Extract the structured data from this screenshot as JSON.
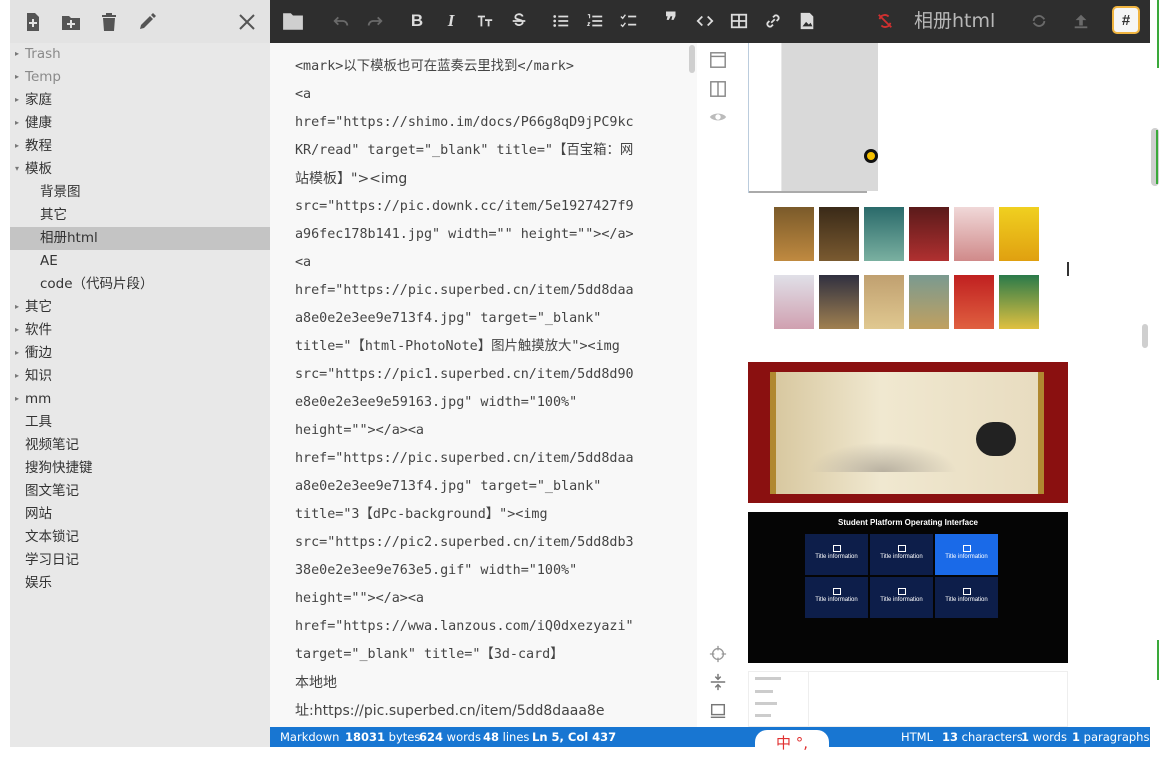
{
  "sidebar": {
    "tree": [
      {
        "label": "Trash",
        "arrow": "▸",
        "muted": true
      },
      {
        "label": "Temp",
        "arrow": "▸",
        "muted": true
      },
      {
        "label": "家庭",
        "arrow": "▸"
      },
      {
        "label": "健康",
        "arrow": "▸"
      },
      {
        "label": "教程",
        "arrow": "▸"
      },
      {
        "label": "模板",
        "arrow": "▾"
      },
      {
        "label": "背景图",
        "child": true
      },
      {
        "label": "其它",
        "child": true
      },
      {
        "label": "相册html",
        "child": true,
        "active": true
      },
      {
        "label": "AE",
        "child": true
      },
      {
        "label": "code（代码片段）",
        "child": true
      },
      {
        "label": "其它",
        "arrow": "▸"
      },
      {
        "label": "软件",
        "arrow": "▸"
      },
      {
        "label": "衝边",
        "arrow": "▸"
      },
      {
        "label": "知识",
        "arrow": "▸"
      },
      {
        "label": "mm",
        "arrow": "▸"
      },
      {
        "label": "工具"
      },
      {
        "label": "视频笔记"
      },
      {
        "label": "搜狗快捷键"
      },
      {
        "label": "图文笔记"
      },
      {
        "label": "网站"
      },
      {
        "label": "文本锁记"
      },
      {
        "label": "学习日记"
      },
      {
        "label": "娱乐"
      }
    ]
  },
  "toolbar": {
    "title": "相册html",
    "tag_button": "#"
  },
  "editor": {
    "lines": [
      "<mark>以下模板也可在蓝奏云里找到</mark>",
      "<a",
      "href=\"https://shimo.im/docs/P66g8qD9jPC9kc",
      "KR/read\" target=\"_blank\" title=\"【百宝箱：网",
      "站模板】\"><img",
      "src=\"https://pic.downk.cc/item/5e1927427f9",
      "a96fec178b141.jpg\" width=\"\" height=\"\"></a>",
      "<a",
      "href=\"https://pic.superbed.cn/item/5dd8daa",
      "a8e0e2e3ee9e713f4.jpg\" target=\"_blank\"",
      "title=\"【html-PhotoNote】图片触摸放大\"><img",
      "src=\"https://pic1.superbed.cn/item/5dd8d90",
      "e8e0e2e3ee9e59163.jpg\" width=\"100%\"",
      "height=\"\"></a><a",
      "href=\"https://pic.superbed.cn/item/5dd8daa",
      "a8e0e2e3ee9e713f4.jpg\" target=\"_blank\"",
      "title=\"3【dPc-background】\"><img",
      "src=\"https://pic2.superbed.cn/item/5dd8db3",
      "38e0e2e3ee9e763e5.gif\" width=\"100%\"",
      "height=\"\"></a><a",
      "href=\"https://wwa.lanzous.com/iQ0dxezyazi\"",
      "target=\"_blank\" title=\"【3d-card】",
      "本地地",
      "址:https://pic.superbed.cn/item/5dd8daaa8e"
    ]
  },
  "preview": {
    "panel_title": "Student Platform Operating Interface",
    "cards": [
      {
        "label": "Title information"
      },
      {
        "label": "Title information"
      },
      {
        "label": "Title information",
        "active": true
      },
      {
        "label": "Title information"
      },
      {
        "label": "Title information"
      },
      {
        "label": "Title information"
      }
    ]
  },
  "status": {
    "mode": "Markdown",
    "bytes": "18031",
    "bytes_label": "bytes",
    "words": "624",
    "words_label": "words",
    "lines": "48",
    "lines_label": "lines",
    "cursor": "Ln 5, Col 437",
    "ime": "中 °,",
    "format": "HTML",
    "characters": "13",
    "characters_label": "characters",
    "p_words": "1",
    "p_words_label": "words",
    "paragraphs": "1",
    "paragraphs_label": "paragraphs"
  },
  "colors": {
    "statusbar": "#1876d2",
    "toolbar": "#2e2e2e",
    "sidebar": "#e8e8e8",
    "active_item": "#c4c4c4"
  }
}
